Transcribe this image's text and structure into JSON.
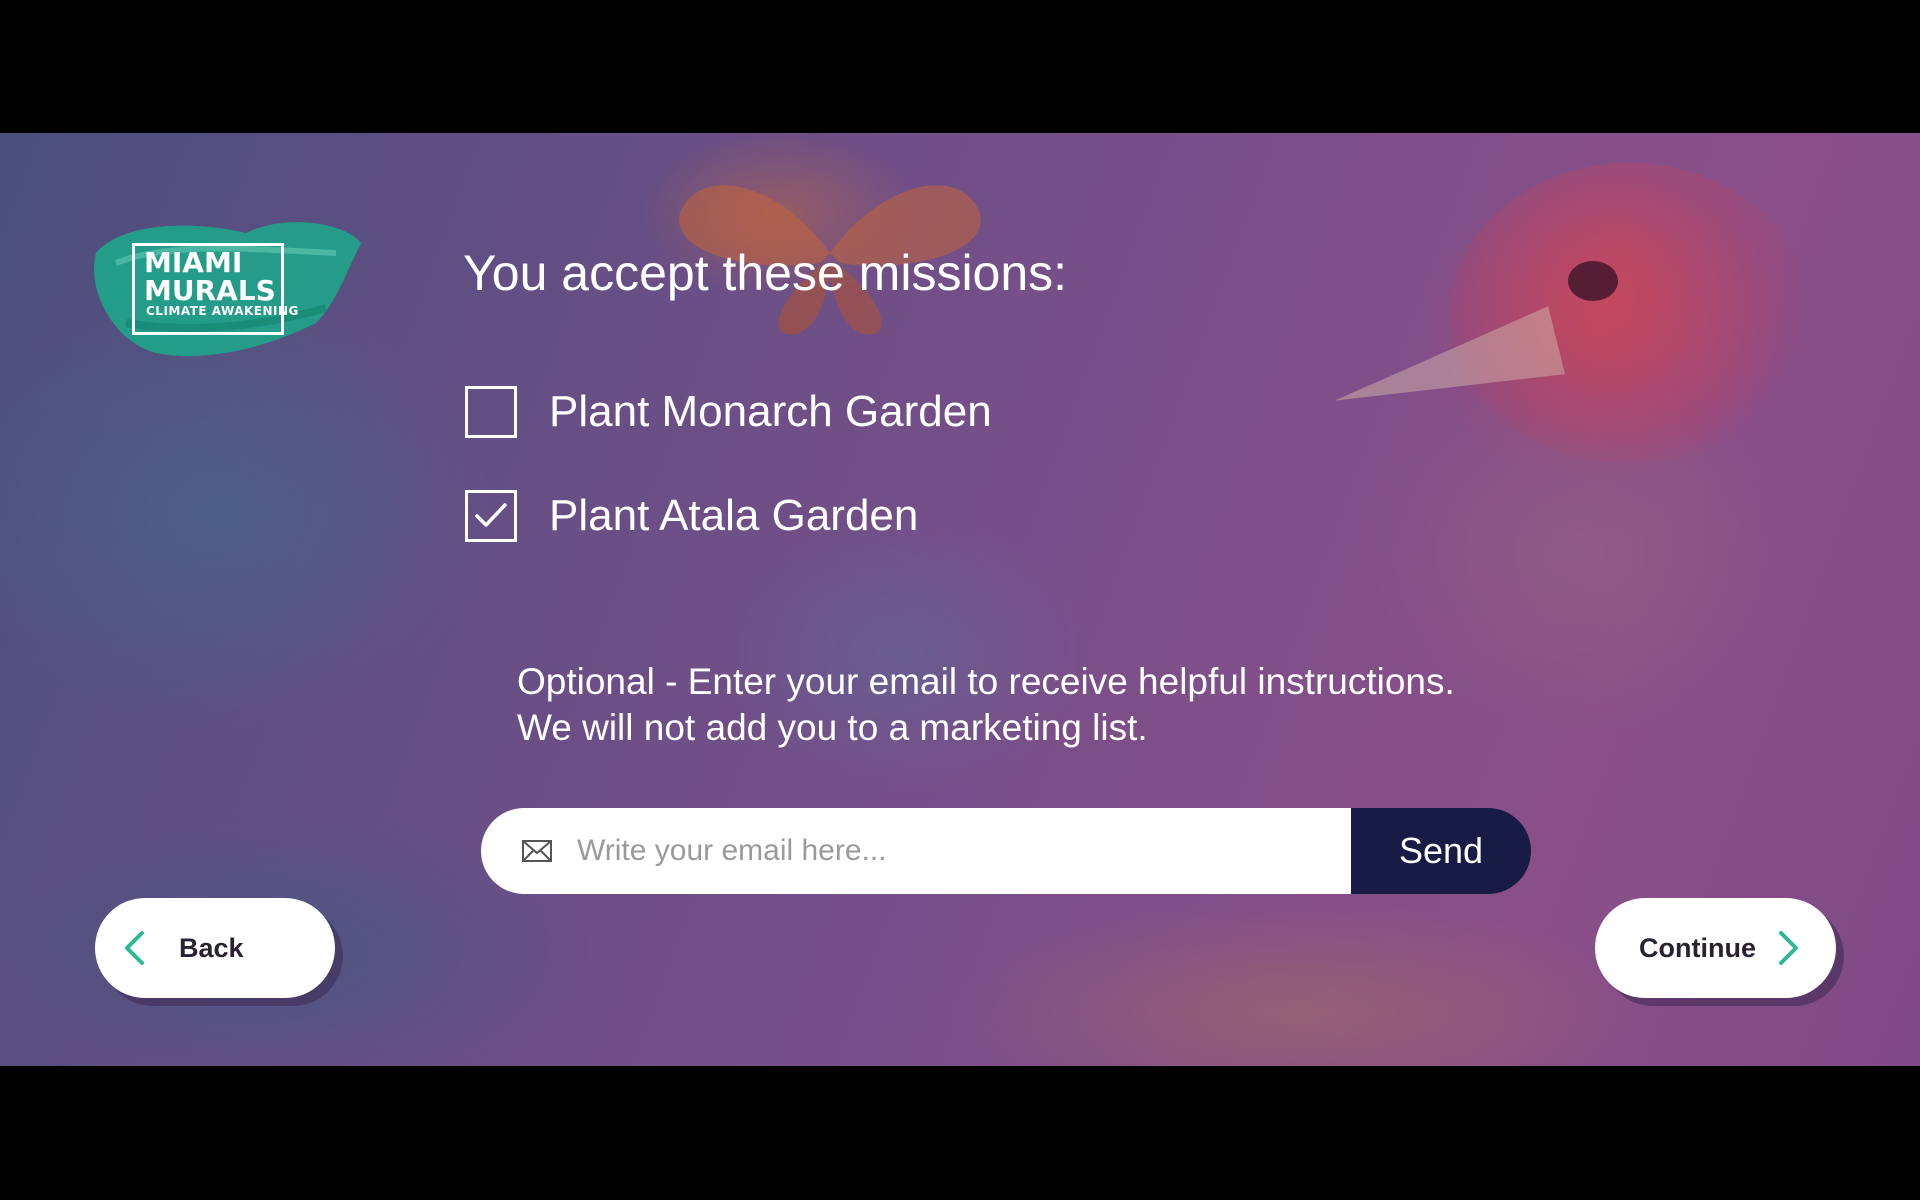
{
  "logo": {
    "line1": "MIAMI",
    "line1b": "MURALS",
    "line2": "CLIMATE AWAKENING"
  },
  "title": "You accept these missions:",
  "missions": [
    {
      "label": "Plant Monarch Garden",
      "checked": false
    },
    {
      "label": "Plant Atala Garden",
      "checked": true
    }
  ],
  "optional": {
    "line1": "Optional - Enter your email to receive helpful instructions.",
    "line2": "We will not add you to a marketing list."
  },
  "email": {
    "placeholder": "Write your email here...",
    "value": "",
    "icon": "envelope-icon"
  },
  "send_label": "Send",
  "nav": {
    "back_label": "Back",
    "continue_label": "Continue"
  },
  "colors": {
    "accent": "#2fb79a",
    "send_bg": "#181c45",
    "logo_brush": "#1fa38a"
  }
}
